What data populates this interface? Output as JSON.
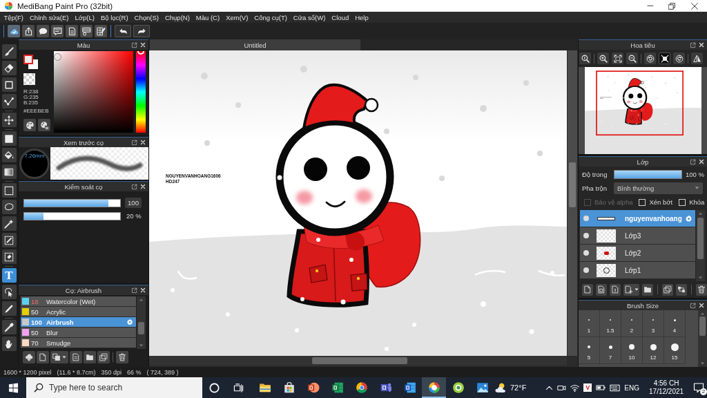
{
  "window": {
    "title": "MediBang Paint Pro (32bit)"
  },
  "menu": [
    "Tệp(F)",
    "Chỉnh sửa(E)",
    "Lớp(L)",
    "Bộ lọc(R)",
    "Chọn(S)",
    "Chụp(N)",
    "Màu (C)",
    "Xem(V)",
    "Công cụ(T)",
    "Cửa sổ(W)",
    "Cloud",
    "Help"
  ],
  "toolbar": [
    [
      {
        "kind": "cloud",
        "on": true
      },
      {
        "kind": "share",
        "on": false
      },
      {
        "kind": "balloon",
        "on": false
      },
      {
        "kind": "comment",
        "on": false
      },
      {
        "kind": "page",
        "on": false
      },
      {
        "kind": "list",
        "on": false
      },
      {
        "kind": "checklist",
        "on": false
      }
    ],
    [
      {
        "kind": "undo",
        "on": false
      },
      {
        "kind": "redo",
        "on": false
      }
    ]
  ],
  "tool_groups": [
    [
      {
        "kind": "brush",
        "selected": false
      },
      {
        "kind": "eraser",
        "selected": false
      },
      {
        "kind": "dot",
        "selected": false
      },
      {
        "kind": "curve",
        "selected": false
      }
    ],
    [
      {
        "kind": "move",
        "selected": false
      }
    ],
    [
      {
        "kind": "fill",
        "selected": false
      },
      {
        "kind": "bucket",
        "selected": false
      },
      {
        "kind": "gradient",
        "selected": false
      }
    ],
    [
      {
        "kind": "select",
        "selected": false
      },
      {
        "kind": "lasso",
        "selected": false
      },
      {
        "kind": "wand",
        "selected": false
      },
      {
        "kind": "select_pen",
        "selected": false
      },
      {
        "kind": "select_eraser",
        "selected": false
      }
    ],
    [
      {
        "kind": "text",
        "selected": true,
        "glyph": "T"
      },
      {
        "kind": "operation",
        "selected": false
      },
      {
        "kind": "divide",
        "selected": false
      }
    ],
    [
      {
        "kind": "eyedropper",
        "selected": false
      },
      {
        "kind": "hand",
        "selected": false
      }
    ]
  ],
  "color_panel": {
    "title": "Màu",
    "channels": [
      "R:238",
      "G:235",
      "B:235"
    ],
    "hex": "#EEEBEB",
    "hue": {
      "level": 0
    }
  },
  "brush_preview": {
    "title": "Xem trước cọ",
    "tip_size": "7.26mm"
  },
  "brush_control": {
    "title": "Kiểm soát cọ",
    "sliders": [
      {
        "kind": "spin",
        "level": 0.88,
        "reading": "100"
      },
      {
        "kind": "plain",
        "level": 0.2,
        "reading": "20 %"
      }
    ]
  },
  "brush_list": {
    "title": "Cọ: Airbrush",
    "items": [
      {
        "color": "#5bd0ef",
        "size": "18",
        "size_alert": true,
        "name": "Watercolor (Wet)",
        "selected": false
      },
      {
        "color": "#e6d000",
        "size": "50",
        "size_alert": false,
        "name": "Acrylic",
        "selected": false
      },
      {
        "color": "#c8c8c8",
        "size": "100",
        "size_alert": false,
        "name": "Airbrush",
        "selected": true
      },
      {
        "color": "#f0a2f0",
        "size": "50",
        "size_alert": false,
        "name": "Blur",
        "selected": false
      },
      {
        "color": "#fad8c0",
        "size": "70",
        "size_alert": false,
        "name": "Smudge",
        "selected": false
      }
    ]
  },
  "document": {
    "tab": "Untitled",
    "signature": [
      "NGUYENVANHOANG1606",
      "HD247"
    ]
  },
  "navigator": {
    "title": "Hoa tiêu",
    "tools": [
      [
        {
          "kind": "zoom_actual",
          "on": false
        }
      ],
      [
        {
          "kind": "zoom_in",
          "on": false
        },
        {
          "kind": "fit",
          "on": false
        },
        {
          "kind": "zoom_out",
          "on": false
        }
      ],
      [
        {
          "kind": "rotate_left",
          "on": false
        },
        {
          "kind": "fit_screen",
          "on": true
        },
        {
          "kind": "rotate_right",
          "on": false
        }
      ],
      [
        {
          "kind": "flip",
          "on": false
        }
      ]
    ]
  },
  "layers": {
    "title": "Lớp",
    "opacity_label": "Độ trong",
    "opacity": {
      "level": 1,
      "reading": "100 %"
    },
    "blend_label": "Pha trộn",
    "blend_mode": "Bình thường",
    "options": [
      {
        "label": "Bảo vệ alpha",
        "checked": false,
        "disabled": true
      },
      {
        "label": "Xén bớt",
        "checked": false,
        "disabled": false
      },
      {
        "label": "Khóa",
        "checked": false,
        "disabled": false
      }
    ],
    "items": [
      {
        "name": "nguyenvanhoang",
        "kind": "text",
        "visible": true,
        "selected": true
      },
      {
        "name": "Lớp3",
        "kind": "empty",
        "visible": true,
        "selected": false
      },
      {
        "name": "Lớp2",
        "kind": "marks",
        "visible": true,
        "selected": false
      },
      {
        "name": "Lớp1",
        "kind": "sketch",
        "visible": true,
        "selected": false
      }
    ]
  },
  "brush_size": {
    "title": "Brush Size",
    "sizes": [
      "1",
      "1.5",
      "2",
      "3",
      "4",
      "5",
      "7",
      "10",
      "12",
      "15"
    ]
  },
  "status_bar": [
    "1600 * 1200 pixel",
    "(11.6 * 8.7cm)",
    "350 dpi",
    "66 %",
    "( 724, 389 )"
  ],
  "taskbar": {
    "search_placeholder": "Type here to search",
    "apps": [
      {
        "kind": "explorer",
        "active": false
      },
      {
        "kind": "store",
        "active": false
      },
      {
        "kind": "powerpoint",
        "active": false
      },
      {
        "kind": "excel",
        "active": false
      },
      {
        "kind": "chrome",
        "active": false
      },
      {
        "kind": "teams",
        "active": false
      },
      {
        "kind": "word",
        "active": false
      },
      {
        "kind": "medibang",
        "active": true
      },
      {
        "kind": "paint_tool",
        "active": false
      },
      {
        "kind": "photos",
        "active": false
      }
    ],
    "weather": "72°F",
    "ime": "V",
    "language": "ENG",
    "time": "4:56 CH",
    "date": "17/12/2021",
    "notifications": "2"
  }
}
